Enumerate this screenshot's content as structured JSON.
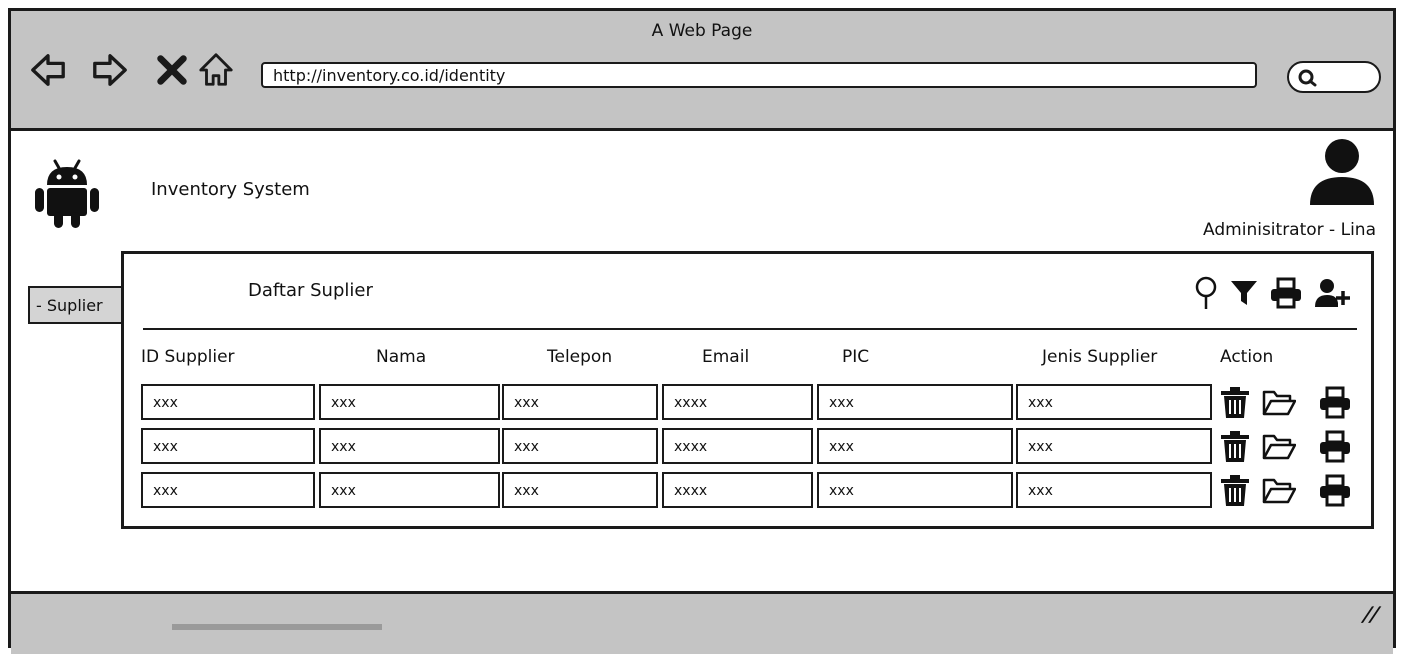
{
  "browser": {
    "window_title": "A Web Page",
    "url": "http://inventory.co.id/identity",
    "nav_icons": [
      "back-arrow-icon",
      "forward-arrow-icon",
      "stop-x-icon",
      "home-icon"
    ],
    "search_icon": "search-icon"
  },
  "header": {
    "logo_icon": "android-icon",
    "app_title": "Inventory System",
    "avatar_icon": "user-avatar-icon",
    "user_label": "Adminisitrator - Lina"
  },
  "sidebar": {
    "tab_label": "- Suplier"
  },
  "panel": {
    "title": "Daftar Suplier",
    "toolbar_icons": [
      "location-pin-icon",
      "filter-icon",
      "printer-icon",
      "add-user-icon"
    ],
    "columns": [
      "ID Supplier",
      "Nama",
      "Telepon",
      "Email",
      "PIC",
      "Jenis Supplier",
      "Action"
    ],
    "rows": [
      [
        "xxx",
        "xxx",
        "xxx",
        "xxxx",
        "xxx",
        "xxx"
      ],
      [
        "xxx",
        "xxx",
        "xxx",
        "xxxx",
        "xxx",
        "xxx"
      ],
      [
        "xxx",
        "xxx",
        "xxx",
        "xxxx",
        "xxx",
        "xxx"
      ]
    ],
    "row_actions": [
      "trash-icon",
      "open-folder-icon",
      "printer-icon"
    ]
  },
  "colors": {
    "chrome_gray": "#c4c4c4",
    "tab_gray": "#d4d4d4",
    "ink": "#1a1a1a"
  }
}
